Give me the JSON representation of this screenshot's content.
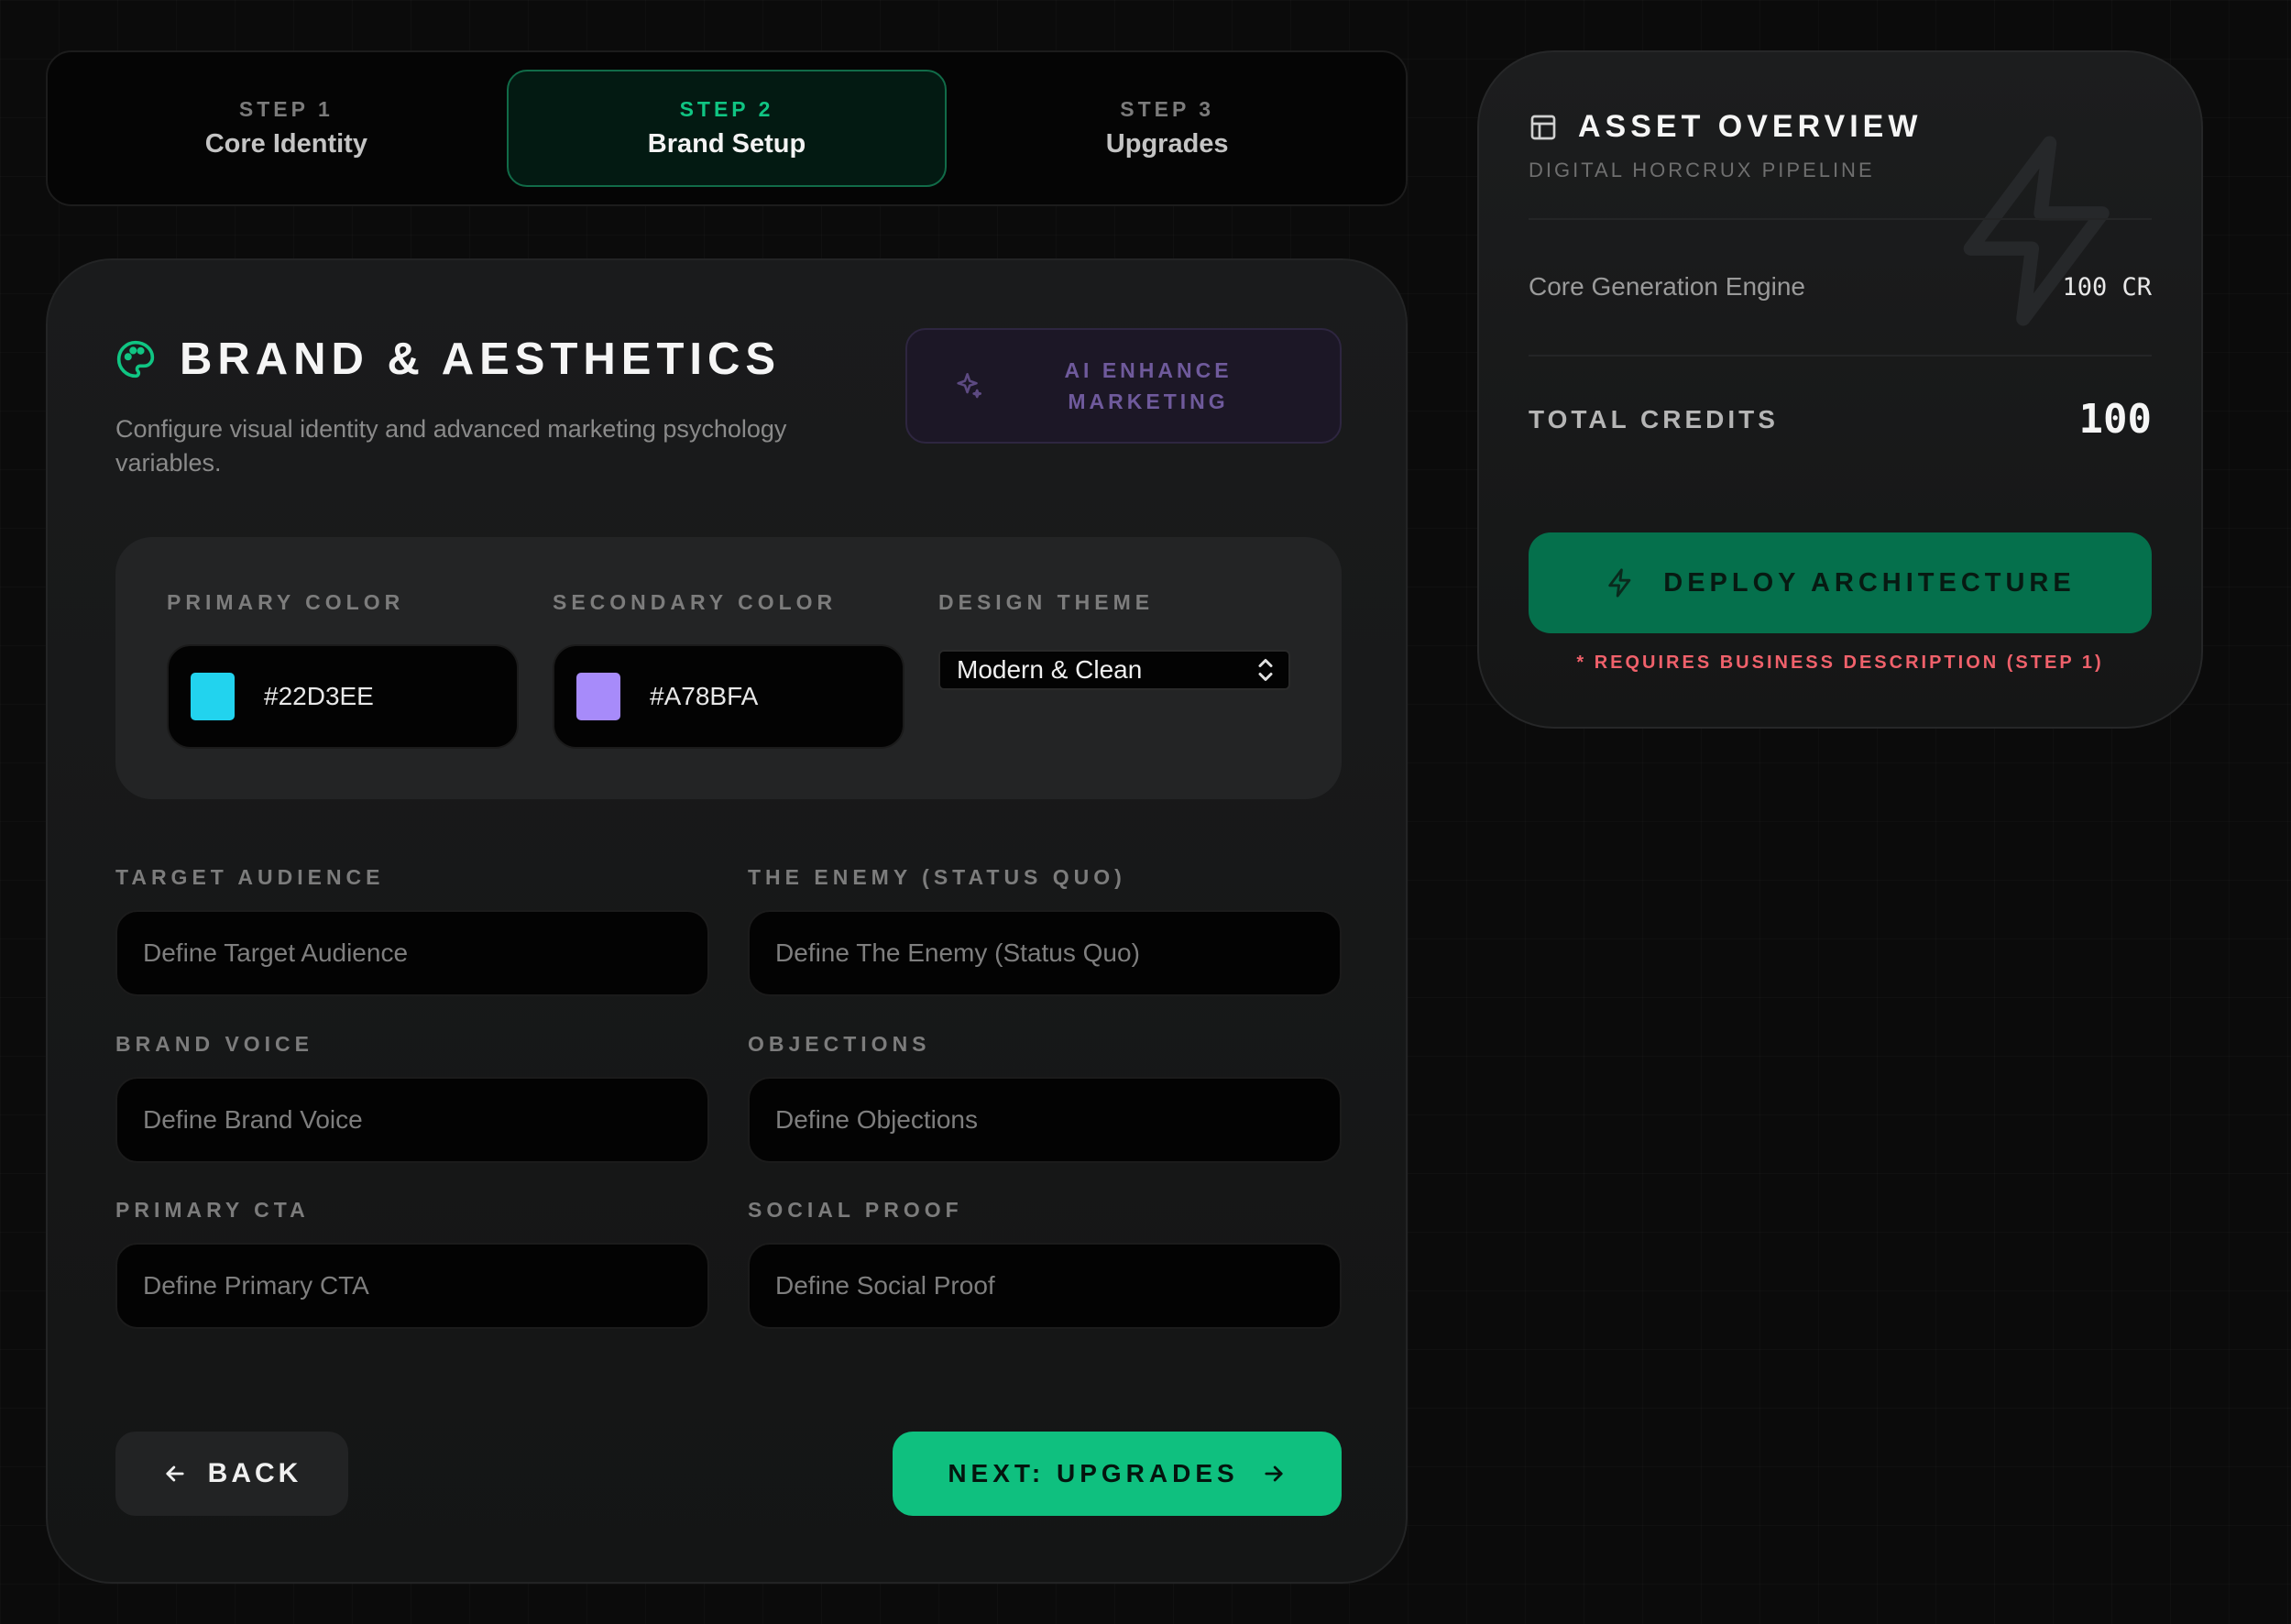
{
  "stepper": {
    "steps": [
      {
        "num": "STEP 1",
        "name": "Core Identity",
        "active": false
      },
      {
        "num": "STEP 2",
        "name": "Brand Setup",
        "active": true
      },
      {
        "num": "STEP 3",
        "name": "Upgrades",
        "active": false
      }
    ]
  },
  "brand": {
    "title": "BRAND & AESTHETICS",
    "description": "Configure visual identity and advanced marketing psychology variables.",
    "ai_button_label": "AI ENHANCE MARKETING",
    "primary_color": {
      "label": "PRIMARY COLOR",
      "value": "#22D3EE"
    },
    "secondary_color": {
      "label": "SECONDARY COLOR",
      "value": "#A78BFA"
    },
    "design_theme": {
      "label": "DESIGN THEME",
      "value": "Modern & Clean"
    },
    "fields": [
      {
        "label": "TARGET AUDIENCE",
        "placeholder": "Define Target Audience"
      },
      {
        "label": "THE ENEMY (STATUS QUO)",
        "placeholder": "Define The Enemy (Status Quo)"
      },
      {
        "label": "BRAND VOICE",
        "placeholder": "Define Brand Voice"
      },
      {
        "label": "OBJECTIONS",
        "placeholder": "Define Objections"
      },
      {
        "label": "PRIMARY CTA",
        "placeholder": "Define Primary CTA"
      },
      {
        "label": "SOCIAL PROOF",
        "placeholder": "Define Social Proof"
      }
    ],
    "back_label": "BACK",
    "next_label": "NEXT: UPGRADES"
  },
  "overview": {
    "title": "ASSET OVERVIEW",
    "subtitle": "DIGITAL HORCRUX PIPELINE",
    "engine_label": "Core Generation Engine",
    "engine_value": "100 CR",
    "total_label": "TOTAL CREDITS",
    "total_value": "100",
    "deploy_label": "DEPLOY ARCHITECTURE",
    "requirement_note": "* REQUIRES BUSINESS DESCRIPTION (STEP 1)"
  },
  "colors": {
    "accent": "#10C583",
    "deploy": "#05704C",
    "warning": "#F0616B",
    "ai_purple": "#6F5A9C"
  },
  "icons": {
    "title": "palette-icon",
    "ai": "sparkle-icon",
    "overview": "layout-icon",
    "watermark": "bolt-icon",
    "deploy": "bolt-icon",
    "back": "arrow-left-icon",
    "next": "arrow-right-icon",
    "select": "chevron-updown-icon"
  }
}
